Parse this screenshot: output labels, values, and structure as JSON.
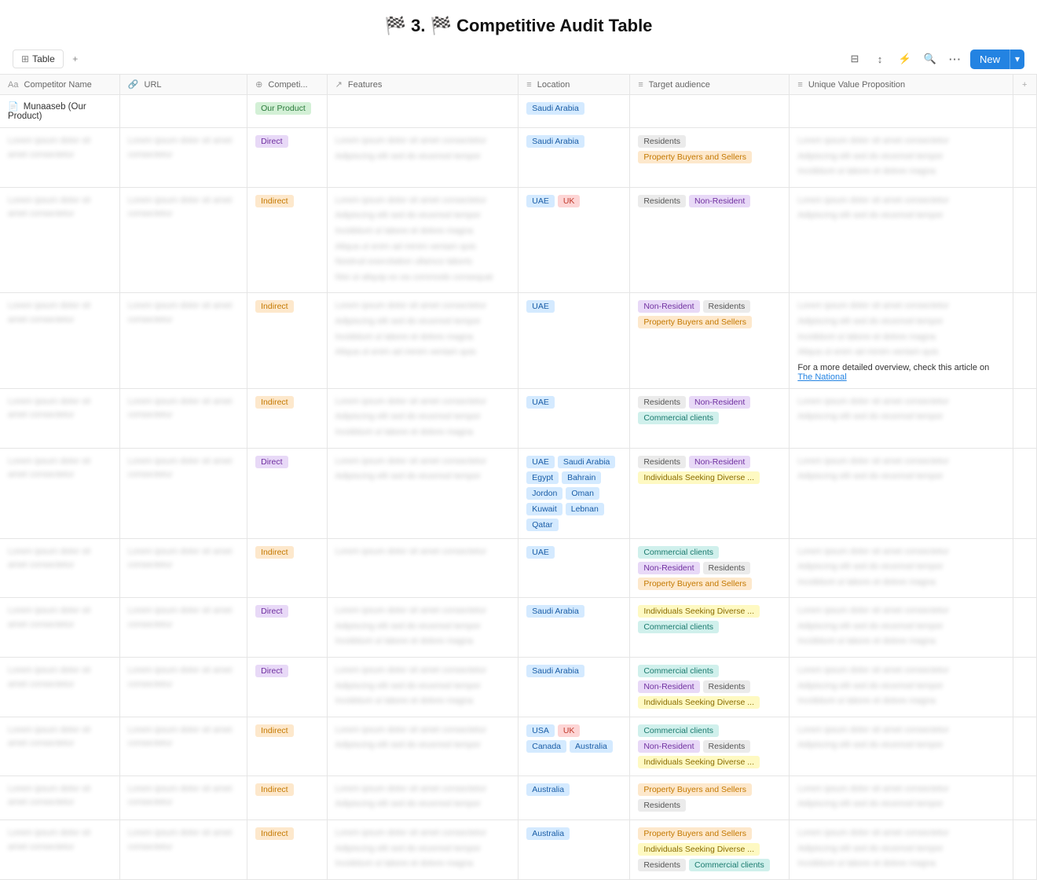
{
  "page": {
    "title": "3. 🏁 Competitive Audit Table",
    "title_icon": "🏁"
  },
  "toolbar": {
    "table_label": "Table",
    "add_view_label": "+",
    "filter_icon": "⊟",
    "sort_icon": "↕",
    "lightning_icon": "⚡",
    "search_icon": "🔍",
    "more_icon": "•••",
    "new_label": "New",
    "new_dropdown": "▾"
  },
  "columns": [
    {
      "icon": "Aa",
      "label": "Competitor Name"
    },
    {
      "icon": "🔗",
      "label": "URL"
    },
    {
      "icon": "⊕",
      "label": "Competi..."
    },
    {
      "icon": "↗",
      "label": "Features"
    },
    {
      "icon": "≡",
      "label": "Location"
    },
    {
      "icon": "≡",
      "label": "Target audience"
    },
    {
      "icon": "≡",
      "label": "Unique Value Proposition"
    }
  ],
  "rows": [
    {
      "name": "Munaaseb (Our Product)",
      "name_icon": "📄",
      "url": "",
      "competition": {
        "label": "Our Product",
        "type": "green"
      },
      "features": "",
      "location": [
        {
          "label": "Saudi Arabia",
          "type": "blue"
        }
      ],
      "target": [],
      "uvp": ""
    },
    {
      "name": "blurred-1",
      "url": "blurred-url-1",
      "competition": {
        "label": "Direct",
        "type": "purple"
      },
      "features": "blurred-feat-1",
      "location": [
        {
          "label": "Saudi Arabia",
          "type": "blue"
        }
      ],
      "target": [
        {
          "label": "Residents",
          "type": "gray"
        },
        {
          "label": "Property Buyers and Sellers",
          "type": "orange"
        }
      ],
      "uvp": "blurred-uvp-1"
    },
    {
      "name": "blurred-2",
      "url": "blurred-url-2",
      "competition": {
        "label": "Indirect",
        "type": "orange"
      },
      "features": "blurred-feat-2",
      "location": [
        {
          "label": "UAE",
          "type": "blue"
        },
        {
          "label": "UK",
          "type": "red"
        }
      ],
      "target": [
        {
          "label": "Residents",
          "type": "gray"
        },
        {
          "label": "Non-Resident",
          "type": "purple"
        }
      ],
      "uvp": "blurred-uvp-2"
    },
    {
      "name": "blurred-3",
      "url": "blurred-url-3",
      "competition": {
        "label": "Indirect",
        "type": "orange"
      },
      "features": "blurred-feat-3",
      "location": [
        {
          "label": "UAE",
          "type": "blue"
        }
      ],
      "target": [
        {
          "label": "Non-Resident",
          "type": "purple"
        },
        {
          "label": "Residents",
          "type": "gray"
        },
        {
          "label": "Property Buyers and Sellers",
          "type": "orange"
        }
      ],
      "uvp": "blurred-uvp-3",
      "uvp_link": "The National"
    },
    {
      "name": "blurred-4",
      "url": "blurred-url-4",
      "competition": {
        "label": "Indirect",
        "type": "orange"
      },
      "features": "blurred-feat-4",
      "location": [
        {
          "label": "UAE",
          "type": "blue"
        }
      ],
      "target": [
        {
          "label": "Residents",
          "type": "gray"
        },
        {
          "label": "Non-Resident",
          "type": "purple"
        },
        {
          "label": "Commercial clients",
          "type": "teal"
        }
      ],
      "uvp": "blurred-uvp-4"
    },
    {
      "name": "blurred-5",
      "url": "blurred-url-5",
      "competition": {
        "label": "Direct",
        "type": "purple"
      },
      "features": "blurred-feat-5",
      "location": [
        {
          "label": "UAE",
          "type": "blue"
        },
        {
          "label": "Saudi Arabia",
          "type": "blue"
        },
        {
          "label": "Egypt",
          "type": "blue"
        },
        {
          "label": "Bahrain",
          "type": "blue"
        },
        {
          "label": "Jordon",
          "type": "blue"
        },
        {
          "label": "Oman",
          "type": "blue"
        },
        {
          "label": "Kuwait",
          "type": "blue"
        },
        {
          "label": "Lebnan",
          "type": "blue"
        },
        {
          "label": "Qatar",
          "type": "blue"
        }
      ],
      "target": [
        {
          "label": "Residents",
          "type": "gray"
        },
        {
          "label": "Non-Resident",
          "type": "purple"
        },
        {
          "label": "Individuals Seeking Diverse ...",
          "type": "yellow"
        }
      ],
      "uvp": "blurred-uvp-5"
    },
    {
      "name": "blurred-6",
      "url": "blurred-url-6",
      "competition": {
        "label": "Indirect",
        "type": "orange"
      },
      "features": "blurred-feat-6",
      "location": [
        {
          "label": "UAE",
          "type": "blue"
        }
      ],
      "target": [
        {
          "label": "Commercial clients",
          "type": "teal"
        },
        {
          "label": "Non-Resident",
          "type": "purple"
        },
        {
          "label": "Residents",
          "type": "gray"
        },
        {
          "label": "Property Buyers and Sellers",
          "type": "orange"
        }
      ],
      "uvp": "blurred-uvp-6"
    },
    {
      "name": "blurred-7",
      "url": "blurred-url-7",
      "competition": {
        "label": "Direct",
        "type": "purple"
      },
      "features": "blurred-feat-7",
      "location": [
        {
          "label": "Saudi Arabia",
          "type": "blue"
        }
      ],
      "target": [
        {
          "label": "Individuals Seeking Diverse ...",
          "type": "yellow"
        },
        {
          "label": "Commercial clients",
          "type": "teal"
        }
      ],
      "uvp": "blurred-uvp-7"
    },
    {
      "name": "blurred-8",
      "url": "blurred-url-8",
      "competition": {
        "label": "Direct",
        "type": "purple"
      },
      "features": "blurred-feat-8",
      "location": [
        {
          "label": "Saudi Arabia",
          "type": "blue"
        }
      ],
      "target": [
        {
          "label": "Commercial clients",
          "type": "teal"
        },
        {
          "label": "Non-Resident",
          "type": "purple"
        },
        {
          "label": "Residents",
          "type": "gray"
        },
        {
          "label": "Individuals Seeking Diverse ...",
          "type": "yellow"
        }
      ],
      "uvp": "blurred-uvp-8"
    },
    {
      "name": "blurred-9",
      "url": "blurred-url-9",
      "competition": {
        "label": "Indirect",
        "type": "orange"
      },
      "features": "blurred-feat-9",
      "location": [
        {
          "label": "USA",
          "type": "blue"
        },
        {
          "label": "UK",
          "type": "red"
        },
        {
          "label": "Canada",
          "type": "blue"
        },
        {
          "label": "Australia",
          "type": "blue"
        }
      ],
      "target": [
        {
          "label": "Commercial clients",
          "type": "teal"
        },
        {
          "label": "Non-Resident",
          "type": "purple"
        },
        {
          "label": "Residents",
          "type": "gray"
        },
        {
          "label": "Individuals Seeking Diverse ...",
          "type": "yellow"
        }
      ],
      "uvp": "blurred-uvp-9"
    },
    {
      "name": "blurred-10",
      "url": "blurred-url-10",
      "competition": {
        "label": "Indirect",
        "type": "orange"
      },
      "features": "blurred-feat-10",
      "location": [
        {
          "label": "Australia",
          "type": "blue"
        }
      ],
      "target": [
        {
          "label": "Property Buyers and Sellers",
          "type": "orange"
        },
        {
          "label": "Residents",
          "type": "gray"
        }
      ],
      "uvp": "blurred-uvp-10"
    },
    {
      "name": "blurred-11",
      "url": "blurred-url-11",
      "competition": {
        "label": "Indirect",
        "type": "orange"
      },
      "features": "blurred-feat-11",
      "location": [
        {
          "label": "Australia",
          "type": "blue"
        }
      ],
      "target": [
        {
          "label": "Property Buyers and Sellers",
          "type": "orange"
        },
        {
          "label": "Individuals Seeking Diverse ...",
          "type": "yellow"
        },
        {
          "label": "Residents",
          "type": "gray"
        },
        {
          "label": "Commercial clients",
          "type": "teal"
        }
      ],
      "uvp": "blurred-uvp-11"
    }
  ]
}
